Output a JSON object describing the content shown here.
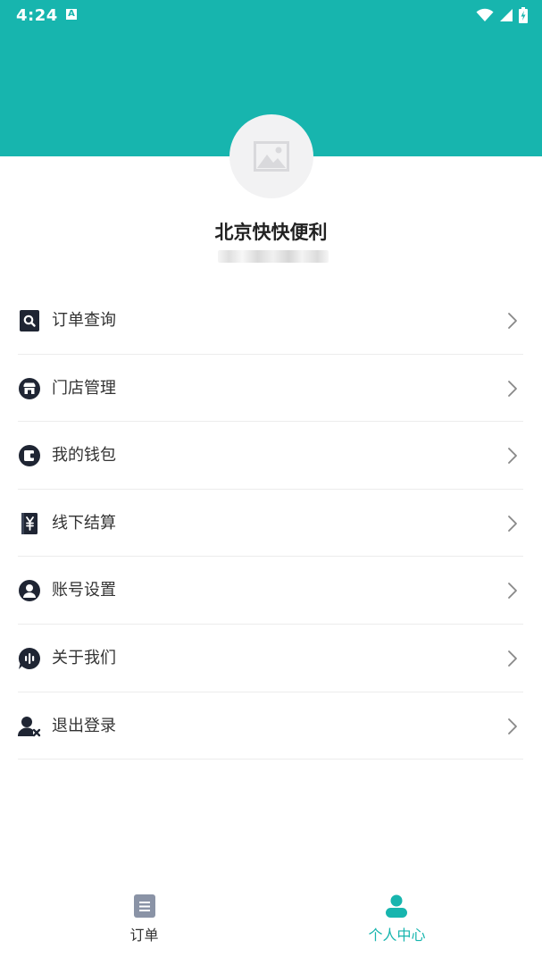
{
  "status_bar": {
    "time": "4:24",
    "notification_glyph": "A"
  },
  "profile": {
    "store_name": "北京快快便利"
  },
  "menu": {
    "items": [
      {
        "label": "订单查询",
        "icon": "order-search-icon"
      },
      {
        "label": "门店管理",
        "icon": "store-icon"
      },
      {
        "label": "我的钱包",
        "icon": "wallet-icon"
      },
      {
        "label": "线下结算",
        "icon": "offline-settlement-icon"
      },
      {
        "label": "账号设置",
        "icon": "account-icon"
      },
      {
        "label": "关于我们",
        "icon": "about-icon"
      },
      {
        "label": "退出登录",
        "icon": "logout-icon"
      }
    ]
  },
  "tab_bar": {
    "tabs": [
      {
        "label": "订单",
        "icon": "document-icon",
        "active": false
      },
      {
        "label": "个人中心",
        "icon": "person-icon",
        "active": true
      }
    ]
  },
  "colors": {
    "brand": "#17b5ae",
    "icon_dark": "#1f2533",
    "tab_inactive": "#8a93a6"
  }
}
